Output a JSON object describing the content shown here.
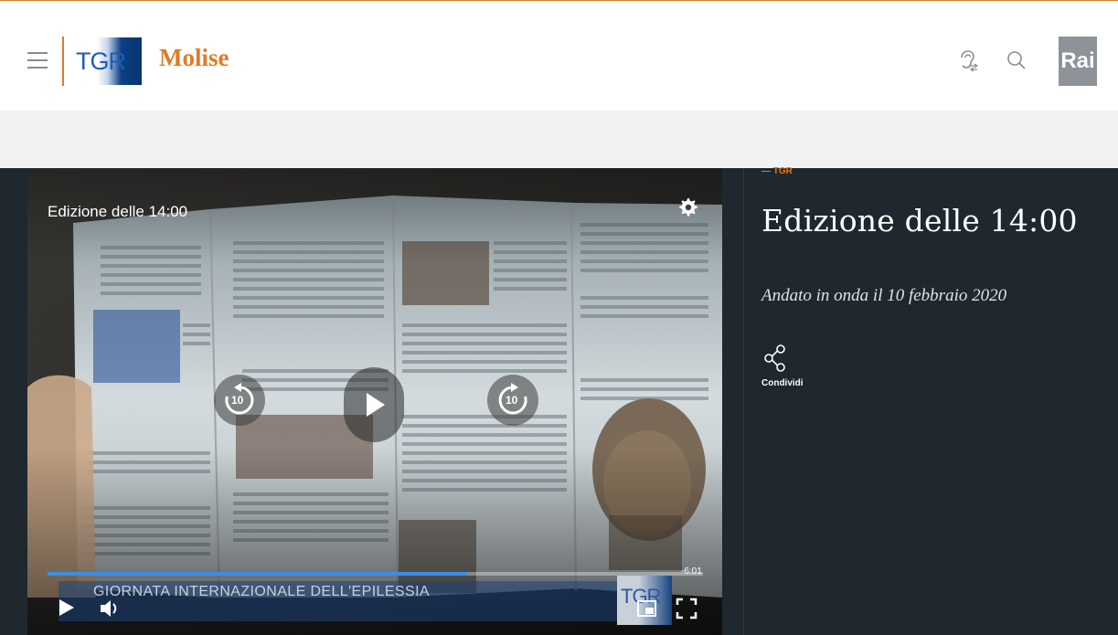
{
  "header": {
    "brand": "TGR",
    "region": "Molise",
    "rai_logo": "Rai",
    "menu_icon": "hamburger-icon",
    "hearing_icon": "hearing-icon",
    "search_icon": "search-icon",
    "accent_color": "#e07b25"
  },
  "player": {
    "title": "Edizione delle 14:00",
    "settings_icon": "gear-icon",
    "rewind_label": "10",
    "forward_label": "10",
    "progress": 0.64,
    "remaining": "-6:01",
    "lower_third_text": "GIORNATA INTERNAZIONALE DELL'EPILESSIA",
    "lower_third_logo": "TGR",
    "controls": [
      "play-icon",
      "volume-icon",
      "picture-in-picture-icon",
      "fullscreen-icon"
    ]
  },
  "details": {
    "kicker": "— TGR",
    "title": "Edizione delle 14:00",
    "aired": "Andato in onda il 10 febbraio 2020",
    "share_label": "Condividi"
  },
  "colors": {
    "panel_bg": "#1e282e",
    "progress_color": "#3a8ee6"
  }
}
